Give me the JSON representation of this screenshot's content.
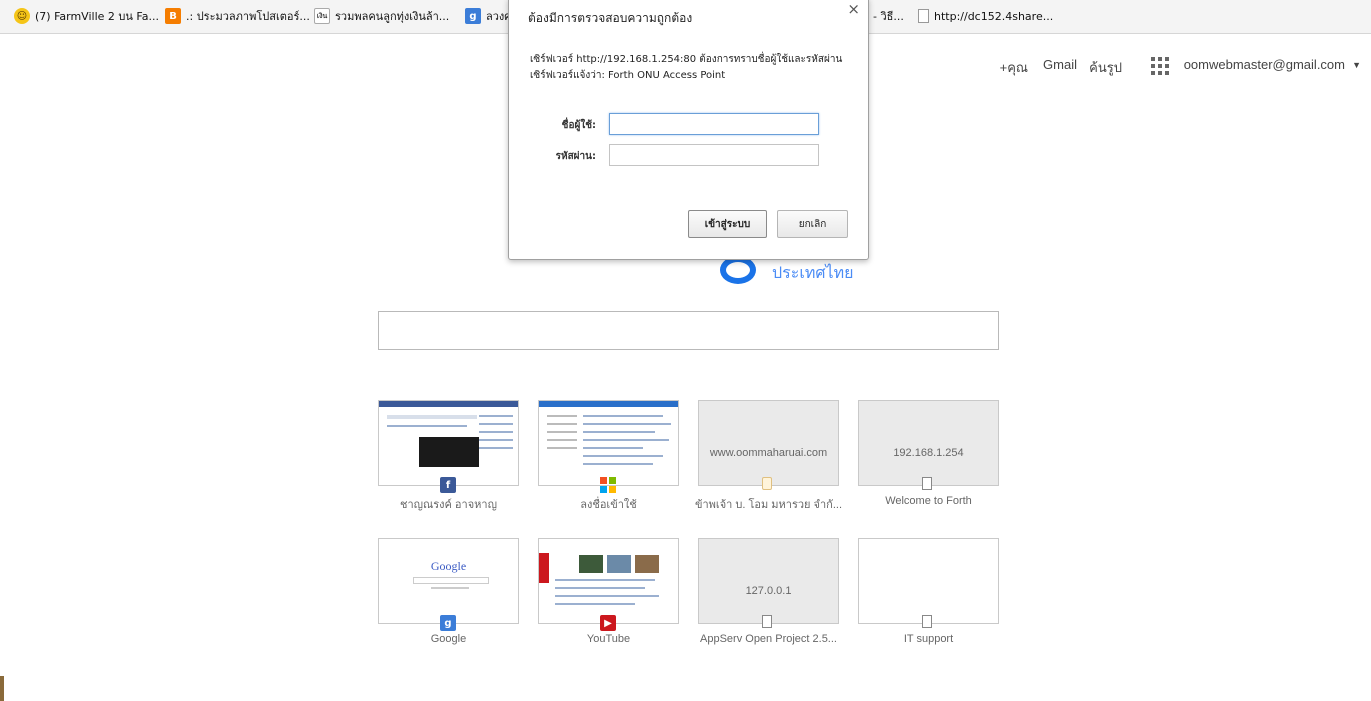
{
  "bookmarks": [
    {
      "label": "(7) FarmVille 2 บน Fa...",
      "icon": "smiley-icon"
    },
    {
      "label": ".: ประมวลภาพโปสเตอร์...",
      "icon": "blogger-icon"
    },
    {
      "label": "รวมพลคนลูกทุ่งเงินล้า...",
      "icon": "site-icon",
      "icon_text": "เงิน"
    },
    {
      "label": "ลวงศ",
      "icon": "google-icon"
    },
    {
      "label": "- วิธี...",
      "icon": ""
    },
    {
      "label": "http://dc152.4share...",
      "icon": "page-icon"
    }
  ],
  "gbar": {
    "plus_you": "+คุณ",
    "gmail": "Gmail",
    "images": "ค้นรูป",
    "account": "oomwebmaster@gmail.com"
  },
  "logo": {
    "country": "ประเทศไทย"
  },
  "search": {
    "placeholder": ""
  },
  "tiles": [
    {
      "caption": "ชาญณรงค์ อาจหาญ",
      "url_text": "",
      "favicon": "facebook-icon"
    },
    {
      "caption": "ลงชื่อเข้าใช้",
      "url_text": "",
      "favicon": "microsoft-icon"
    },
    {
      "caption": "ข้าพเจ้า บ. โอม มหารวย จำกั...",
      "url_text": "www.oommaharuai.com",
      "favicon": "note-icon"
    },
    {
      "caption": "Welcome to Forth",
      "url_text": "192.168.1.254",
      "favicon": "page-icon"
    },
    {
      "caption": "Google",
      "url_text": "",
      "favicon": "google-icon",
      "thumb_text": "Google"
    },
    {
      "caption": "YouTube",
      "url_text": "",
      "favicon": "youtube-icon"
    },
    {
      "caption": "AppServ Open Project 2.5...",
      "url_text": "127.0.0.1",
      "favicon": "page-icon"
    },
    {
      "caption": "IT support",
      "url_text": "",
      "favicon": "page-icon"
    }
  ],
  "dialog": {
    "title": "ต้องมีการตรวจสอบความถูกต้อง",
    "close": "×",
    "message": "เซิร์ฟเวอร์ http://192.168.1.254:80 ต้องการทราบชื่อผู้ใช้และรหัสผ่าน เซิร์ฟเวอร์แจ้งว่า: Forth ONU Access Point",
    "username_label": "ชื่อผู้ใช้:",
    "password_label": "รหัสผ่าน:",
    "username_value": "",
    "password_value": "",
    "login_button": "เข้าสู่ระบบ",
    "cancel_button": "ยกเลิก"
  },
  "colors": {
    "google_blue": "#1a73e8",
    "facebook": "#3b5998",
    "youtube": "#cc181e"
  }
}
